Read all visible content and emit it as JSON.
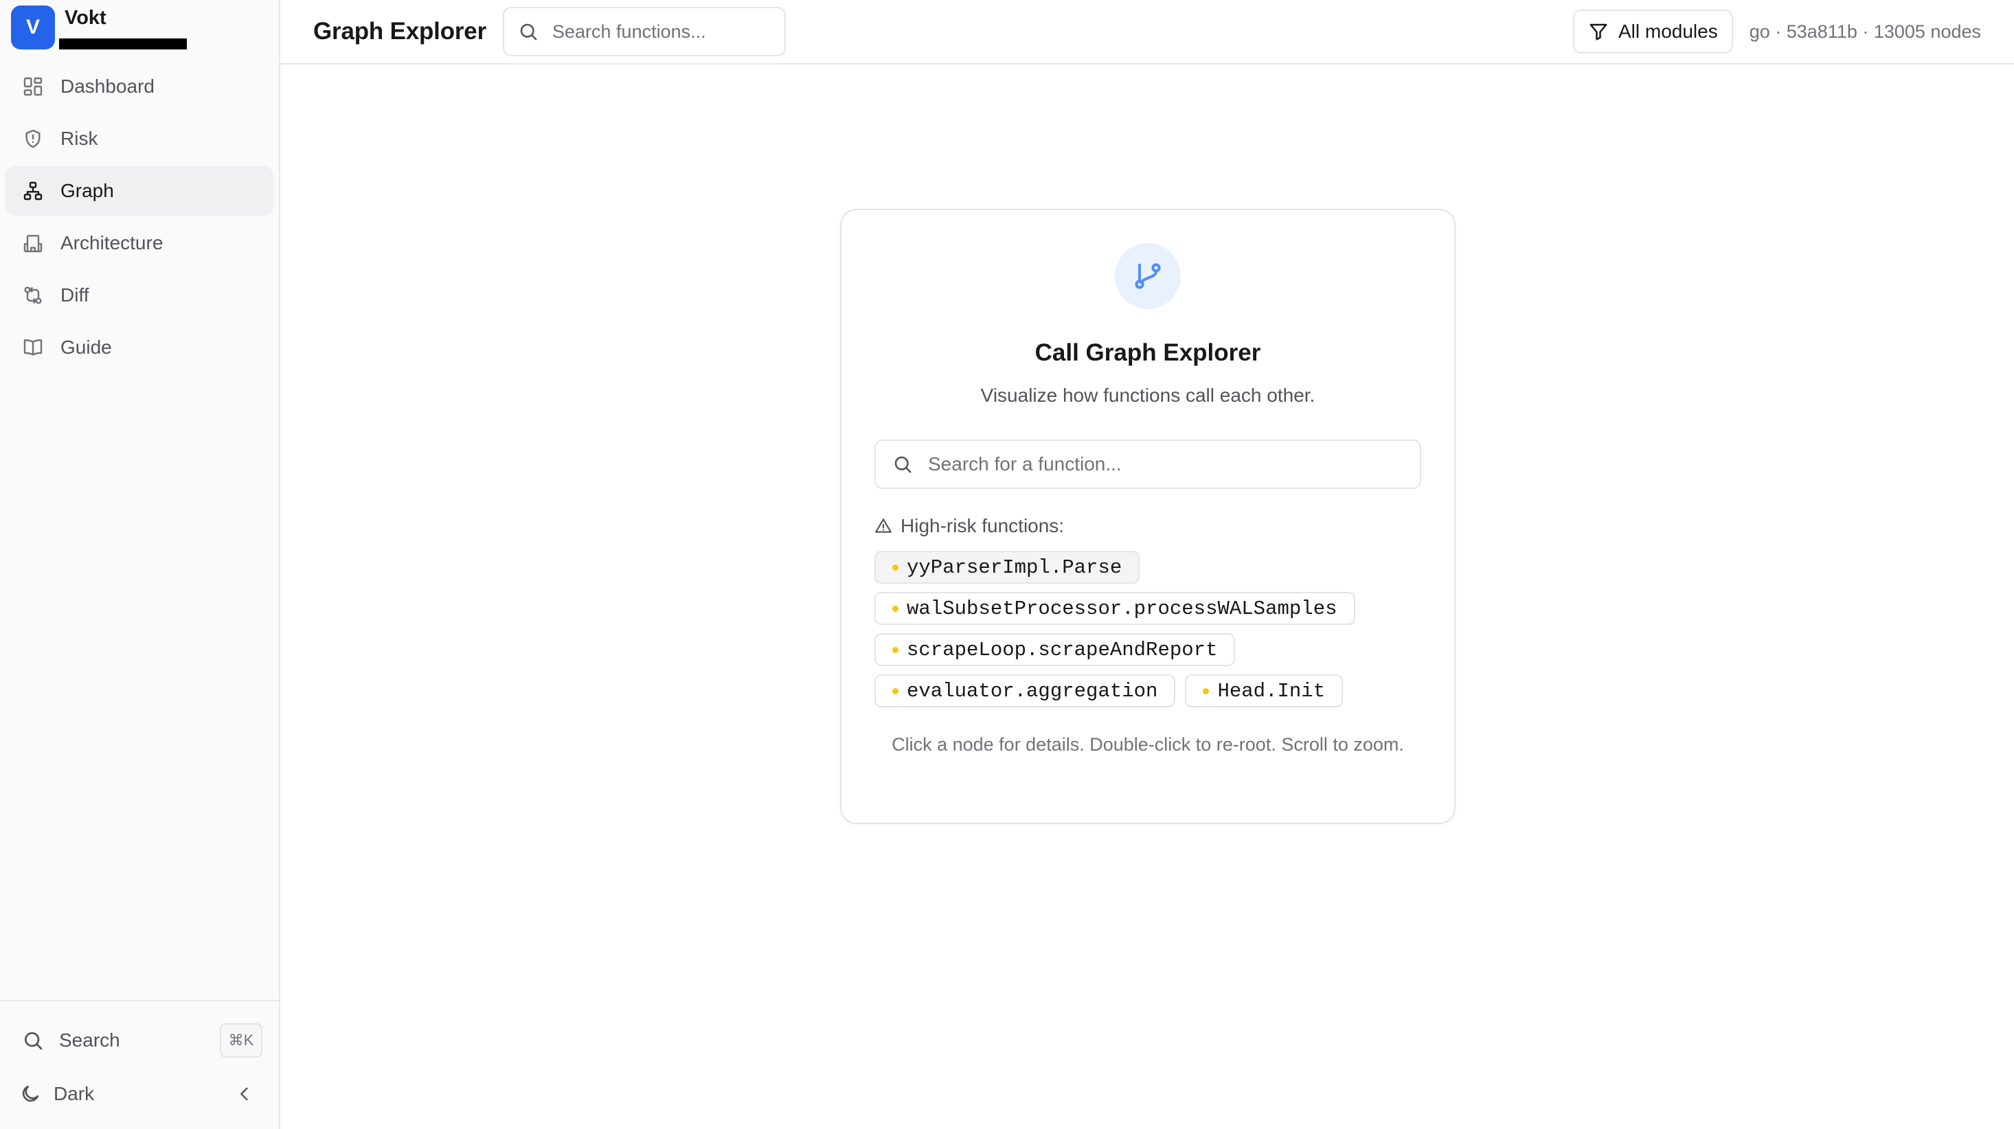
{
  "brand": {
    "initial": "V",
    "name": "Vokt"
  },
  "nav": [
    {
      "id": "dashboard",
      "label": "Dashboard",
      "icon": "dashboard-icon"
    },
    {
      "id": "risk",
      "label": "Risk",
      "icon": "shield-icon"
    },
    {
      "id": "graph",
      "label": "Graph",
      "icon": "graph-icon",
      "active": true
    },
    {
      "id": "architecture",
      "label": "Architecture",
      "icon": "building-icon"
    },
    {
      "id": "diff",
      "label": "Diff",
      "icon": "diff-icon"
    },
    {
      "id": "guide",
      "label": "Guide",
      "icon": "book-icon"
    }
  ],
  "sidebar_bottom": {
    "search_label": "Search",
    "search_shortcut": "⌘K",
    "theme_label": "Dark"
  },
  "header": {
    "title": "Graph Explorer",
    "search_placeholder": "Search functions...",
    "modules_label": "All modules",
    "repo_meta": "go · 53a811b · 13005 nodes"
  },
  "card": {
    "title": "Call Graph Explorer",
    "subtitle": "Visualize how functions call each other.",
    "search_placeholder": "Search for a function...",
    "risk_label": "High-risk functions:",
    "functions": [
      "yyParserImpl.Parse",
      "walSubsetProcessor.processWALSamples",
      "scrapeLoop.scrapeAndReport",
      "evaluator.aggregation",
      "Head.Init"
    ],
    "hint": "Click a node for details. Double-click to re-root. Scroll to zoom."
  },
  "colors": {
    "accent": "#2563eb",
    "risk_dot": "#f5c518",
    "icon_blue": "#4f8ff7"
  }
}
